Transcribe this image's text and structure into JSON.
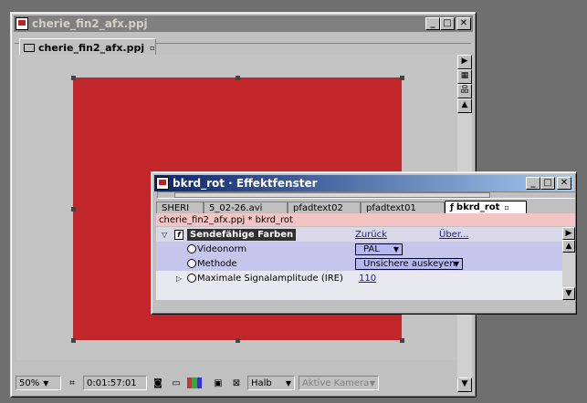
{
  "comp_window": {
    "title": "cherie_fin2_afx.ppj",
    "tab_label": "cherie_fin2_afx.ppj",
    "zoom": "50%",
    "timecode": "0:01:57:01",
    "resolution": "Halb",
    "camera": "Aktive Kamera",
    "layer_color": "#c0262a"
  },
  "fx_window": {
    "title": "bkrd_rot · Effektfenster",
    "tabs": [
      "SHERI",
      "5_02-26.avi",
      "pfadtext02",
      "pfadtext01",
      "bkrd_rot"
    ],
    "breadcrumb": "cherie_fin2_afx.ppj * bkrd_rot",
    "effect": {
      "name": "Sendefähige Farben",
      "reset_link": "Zurück",
      "about_link": "Über..."
    },
    "params": [
      {
        "label": "Videonorm",
        "value": "PAL"
      },
      {
        "label": "Methode",
        "value": "Unsichere auskeyen"
      },
      {
        "label": "Maximale Signalamplitude (IRE)",
        "value": "110"
      }
    ]
  },
  "window_buttons": {
    "minimize": "_",
    "maximize": "□",
    "close": "✕"
  }
}
